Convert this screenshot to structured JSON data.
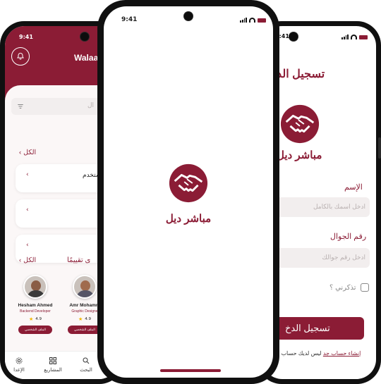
{
  "brand": {
    "name": "مباشر ديل",
    "accent": "#8b1c35"
  },
  "left_phone": {
    "time": "9:41",
    "header_name": "Walaa",
    "search_placeholder": "ال",
    "filter_link": "الكل",
    "cards": [
      {
        "text": "ستخدم"
      },
      {
        "text": ""
      },
      {
        "text": ""
      }
    ],
    "section_title": "ى تقييمًا",
    "section_link": "الكل",
    "people": [
      {
        "name": "Hesham Ahmed",
        "role": "Backend Developer",
        "rating": "4.9",
        "button": "الملف الشخصي"
      },
      {
        "name": "Amr Mohamm",
        "role": "Graphic Designe",
        "rating": "4.9",
        "button": "الملف الشخصي"
      }
    ],
    "nav": [
      {
        "label": "الإعدا",
        "icon": "gear-icon"
      },
      {
        "label": "المشاريع",
        "icon": "grid-icon"
      },
      {
        "label": "البحث",
        "icon": "search-icon"
      }
    ]
  },
  "center_phone": {
    "time": "9:41"
  },
  "right_phone": {
    "time": "9:41",
    "title": "تسجيل الد",
    "name_label": "الإسم",
    "name_placeholder": "ادخل اسمك بالكامل",
    "phone_label": "رقم الجوال",
    "phone_placeholder": "ادخل رقم جوالك",
    "remember_label": "تذكرني ؟",
    "login_button": "تسجيل الدخ",
    "no_account_text": "ليس لديك حساب ؟",
    "create_account_link": "إنشاء حساب جد"
  }
}
